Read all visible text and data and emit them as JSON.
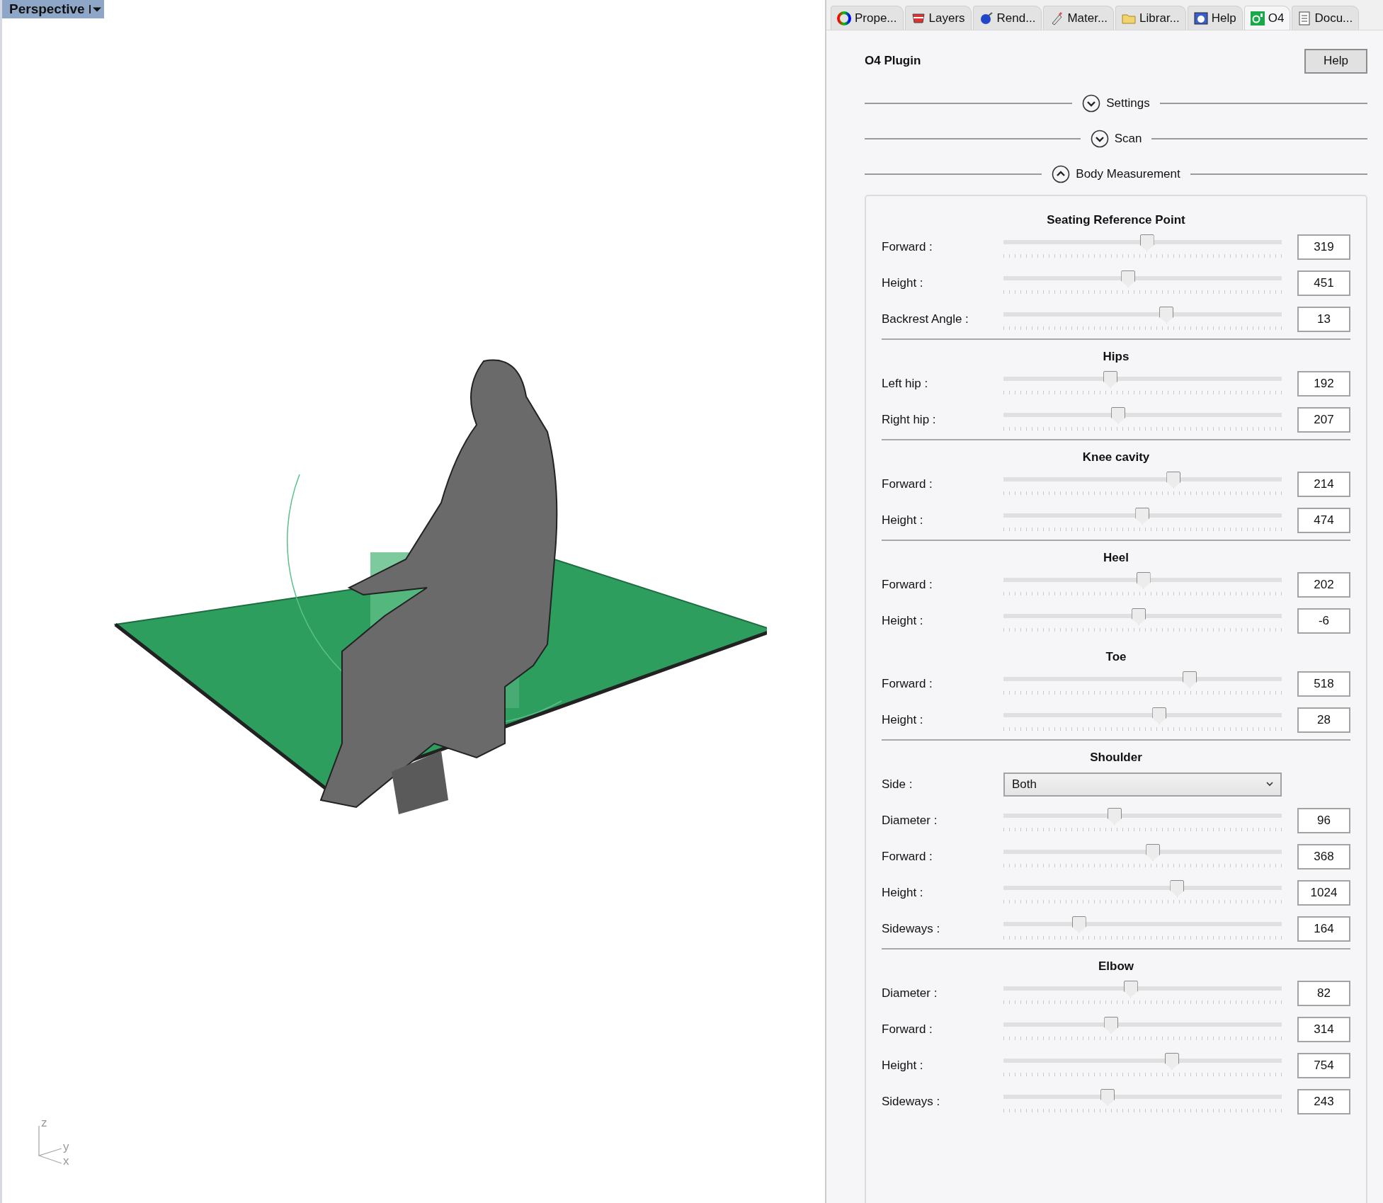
{
  "viewport": {
    "title": "Perspective",
    "axes": {
      "z": "z",
      "y": "y",
      "x": "x"
    }
  },
  "tabs": [
    {
      "label": "Prope...",
      "selected": false
    },
    {
      "label": "Layers",
      "selected": false
    },
    {
      "label": "Rend...",
      "selected": false
    },
    {
      "label": "Mater...",
      "selected": false
    },
    {
      "label": "Librar...",
      "selected": false
    },
    {
      "label": "Help",
      "selected": false
    },
    {
      "label": "O4",
      "selected": true
    },
    {
      "label": "Docu...",
      "selected": false
    }
  ],
  "plugin": {
    "title": "O4 Plugin",
    "help_button": "Help",
    "groups": [
      {
        "label": "Settings",
        "expanded": false
      },
      {
        "label": "Scan",
        "expanded": false
      },
      {
        "label": "Body Measurement",
        "expanded": true
      }
    ],
    "sections": [
      {
        "title": "Seating Reference Point",
        "separated": false,
        "rows": [
          {
            "kind": "slider",
            "label": "Forward :",
            "level": 0.513,
            "value": "319"
          },
          {
            "kind": "slider",
            "label": "Height :",
            "level": 0.446,
            "value": "451"
          },
          {
            "kind": "slider",
            "label": "Backrest Angle :",
            "level": 0.583,
            "value": "13"
          }
        ]
      },
      {
        "title": "Hips",
        "separated": true,
        "rows": [
          {
            "kind": "slider",
            "label": "Left hip :",
            "level": 0.382,
            "value": "192"
          },
          {
            "kind": "slider",
            "label": "Right hip :",
            "level": 0.41,
            "value": "207"
          }
        ]
      },
      {
        "title": "Knee cavity",
        "separated": true,
        "rows": [
          {
            "kind": "slider",
            "label": "Forward :",
            "level": 0.609,
            "value": "214"
          },
          {
            "kind": "slider",
            "label": "Height :",
            "level": 0.497,
            "value": "474"
          }
        ]
      },
      {
        "title": "Heel",
        "separated": true,
        "rows": [
          {
            "kind": "slider",
            "label": "Forward :",
            "level": 0.5,
            "value": "202"
          },
          {
            "kind": "slider",
            "label": "Height :",
            "level": 0.484,
            "value": "-6"
          }
        ]
      },
      {
        "title": "Toe",
        "separated": false,
        "rows": [
          {
            "kind": "slider",
            "label": "Forward :",
            "level": 0.667,
            "value": "518"
          },
          {
            "kind": "slider",
            "label": "Height :",
            "level": 0.558,
            "value": "28"
          }
        ]
      },
      {
        "title": "Shoulder",
        "separated": true,
        "rows": [
          {
            "kind": "dropdown",
            "label": "Side :",
            "value": "Both"
          },
          {
            "kind": "slider",
            "label": "Diameter :",
            "level": 0.397,
            "value": "96"
          },
          {
            "kind": "slider",
            "label": "Forward :",
            "level": 0.535,
            "value": "368"
          },
          {
            "kind": "slider",
            "label": "Height :",
            "level": 0.622,
            "value": "1024"
          },
          {
            "kind": "slider",
            "label": "Sideways :",
            "level": 0.269,
            "value": "164"
          }
        ]
      },
      {
        "title": "Elbow",
        "separated": true,
        "rows": [
          {
            "kind": "slider",
            "label": "Diameter :",
            "level": 0.455,
            "value": "82"
          },
          {
            "kind": "slider",
            "label": "Forward :",
            "level": 0.385,
            "value": "314"
          },
          {
            "kind": "slider",
            "label": "Height :",
            "level": 0.603,
            "value": "754"
          },
          {
            "kind": "slider",
            "label": "Sideways :",
            "level": 0.372,
            "value": "243"
          }
        ]
      }
    ]
  }
}
